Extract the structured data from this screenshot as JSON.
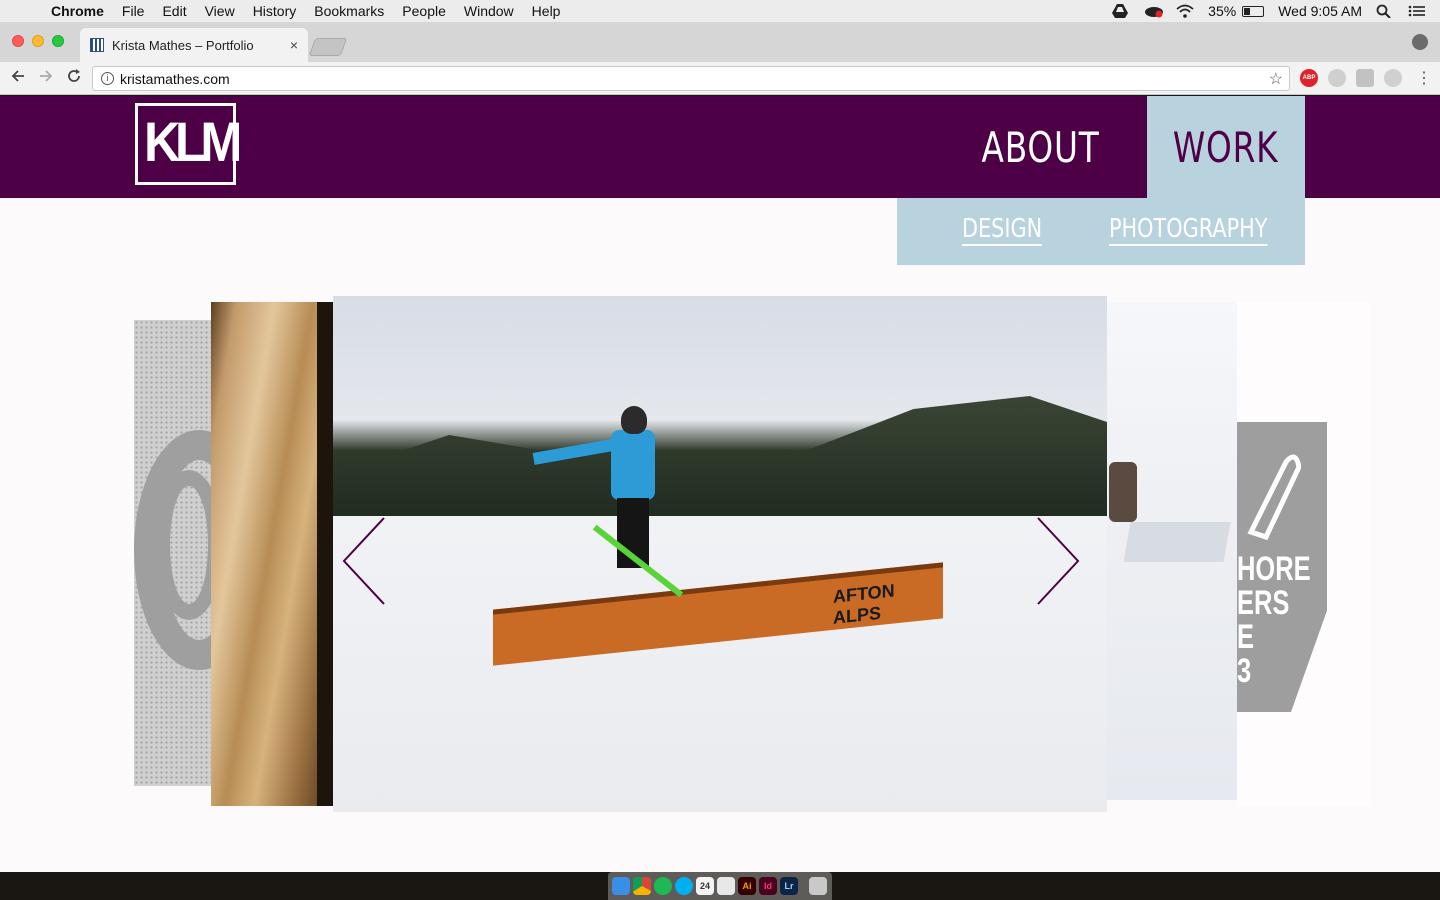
{
  "menubar": {
    "app_name": "Chrome",
    "items": [
      "File",
      "Edit",
      "View",
      "History",
      "Bookmarks",
      "People",
      "Window",
      "Help"
    ],
    "battery": "35%",
    "battery_level": 0.35,
    "clock": "Wed 9:05 AM",
    "icons": [
      "apple-icon",
      "google-drive-icon",
      "creative-cloud-icon",
      "wifi-icon",
      "battery-icon",
      "spotlight-icon",
      "notification-center-icon"
    ]
  },
  "browser": {
    "tab_title": "Krista Mathes – Portfolio",
    "tab_close": "×",
    "url": "kristamathes.com",
    "extensions": [
      "ABP"
    ]
  },
  "site": {
    "logo_text": "KLM",
    "nav": {
      "about": "ABOUT",
      "work": "WORK"
    },
    "dropdown": {
      "design": "DESIGN",
      "photography": "PHOTOGRAPHY"
    },
    "colors": {
      "header": "#4e0046",
      "active_nav": "#b9d3de"
    },
    "carousel": {
      "main_image_sign": "AFTON ALPS",
      "side_image_text": "HORE\nERS\nE\n3"
    }
  },
  "dock": {
    "apps": [
      "Finder",
      "Chrome",
      "Spotify",
      "Skype",
      "Calendar",
      "Preview",
      "Illustrator",
      "InDesign",
      "Lightroom",
      "Trash"
    ],
    "labels": {
      "illustrator": "Ai",
      "indesign": "Id",
      "lightroom": "Lr",
      "calendar": "24"
    }
  }
}
